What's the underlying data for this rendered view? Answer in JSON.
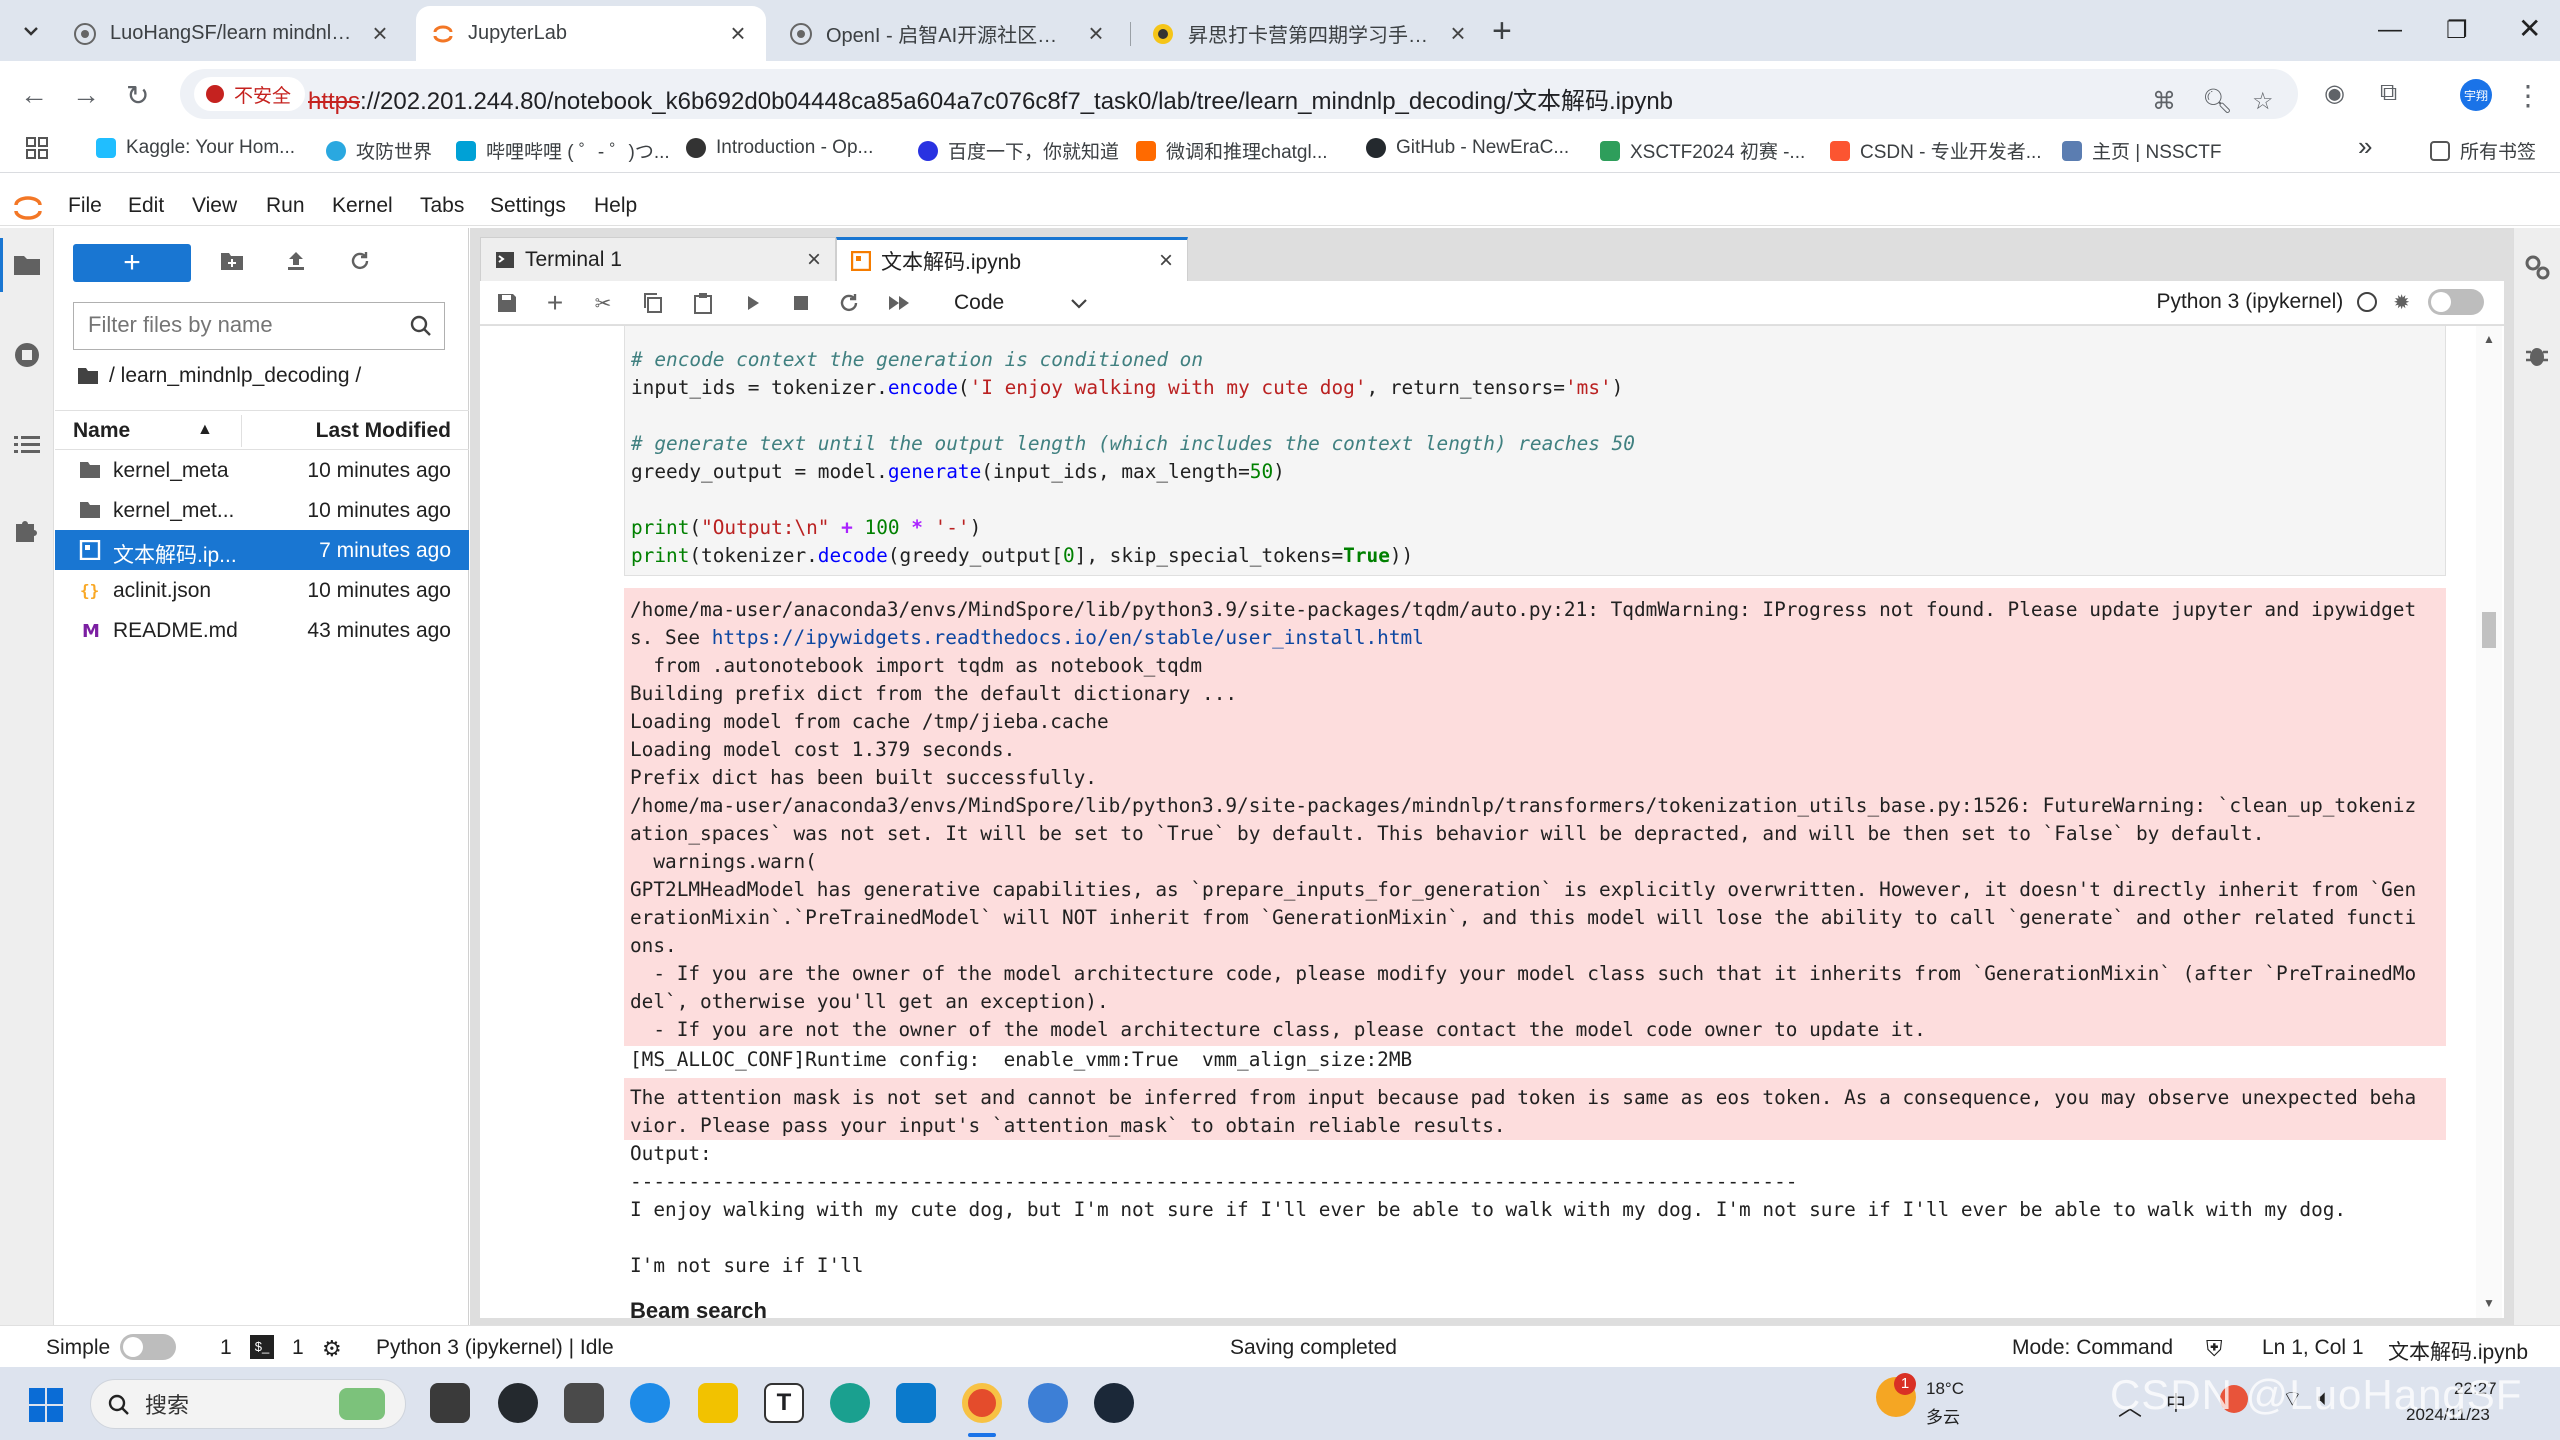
{
  "browser": {
    "tabs": [
      {
        "title": "LuoHangSF/learn mindnlp d",
        "icon": "github-icon"
      },
      {
        "title": "JupyterLab",
        "icon": "jupyter-icon",
        "active": true
      },
      {
        "title": "OpenI - 启智AI开源社区提供普",
        "icon": "openi-icon"
      },
      {
        "title": "昇思打卡营第四期学习手册（记",
        "icon": "mindspore-icon"
      }
    ],
    "security_label": "不安全",
    "url_scheme": "https",
    "url_rest": "://202.201.244.80/notebook_k6b692d0b04448ca85a604a7c076c8f7_task0/lab/tree/learn_mindnlp_decoding/文本解码.ipynb",
    "avatar_label": "宇翔",
    "bookmarks": [
      {
        "label": "Kaggle: Your Hom...",
        "color": "#20beff"
      },
      {
        "label": "攻防世界",
        "color": "#2aa8e0"
      },
      {
        "label": "哔哩哔哩 ( ゜- ゜)つ...",
        "color": "#00a1d6"
      },
      {
        "label": "Introduction - Op...",
        "color": "#333333"
      },
      {
        "label": "百度一下，你就知道",
        "color": "#2932e1"
      },
      {
        "label": "微调和推理chatgl...",
        "color": "#ff6a00"
      },
      {
        "label": "GitHub - NewEraC...",
        "color": "#24292e"
      },
      {
        "label": "XSCTF2024 初赛 -...",
        "color": "#2e9e5b"
      },
      {
        "label": "CSDN - 专业开发者...",
        "color": "#fc5531"
      },
      {
        "label": "主页 | NSSCTF",
        "color": "#5b7db1"
      }
    ],
    "bookmarks_more": "»",
    "all_bookmarks": "所有书签"
  },
  "jupyter": {
    "menu": [
      "File",
      "Edit",
      "View",
      "Run",
      "Kernel",
      "Tabs",
      "Settings",
      "Help"
    ],
    "filter_placeholder": "Filter files by name",
    "breadcrumb": "/ learn_mindnlp_decoding /",
    "columns": {
      "name": "Name",
      "modified": "Last Modified"
    },
    "files": [
      {
        "name": "kernel_meta",
        "modified": "10 minutes ago",
        "type": "folder"
      },
      {
        "name": "kernel_met...",
        "modified": "10 minutes ago",
        "type": "folder"
      },
      {
        "name": "文本解码.ip...",
        "modified": "7 minutes ago",
        "type": "notebook",
        "selected": true
      },
      {
        "name": "aclinit.json",
        "modified": "10 minutes ago",
        "type": "json"
      },
      {
        "name": "README.md",
        "modified": "43 minutes ago",
        "type": "markdown"
      }
    ],
    "doc_tabs": [
      {
        "label": "Terminal 1"
      },
      {
        "label": "文本解码.ipynb",
        "active": true
      }
    ],
    "cell_type": "Code",
    "kernel_name": "Python 3 (ipykernel)"
  },
  "notebook": {
    "code": {
      "c1": "# encode context the generation is conditioned on",
      "l2a": "input_ids = tokenizer.",
      "l2b": "encode",
      "l2c": "(",
      "l2d": "'I enjoy walking with my cute dog'",
      "l2e": ", return_tensors=",
      "l2f": "'ms'",
      "l2g": ")",
      "c3": "# generate text until the output length (which includes the context length) reaches 50",
      "l4a": "greedy_output = model.",
      "l4b": "generate",
      "l4c": "(input_ids, max_length=",
      "l4d": "50",
      "l4e": ")",
      "l5a": "print",
      "l5b": "(",
      "l5c": "\"Output:\\n\"",
      "l5d": " + ",
      "l5e": "100",
      "l5f": " * ",
      "l5g": "'-'",
      "l5h": ")",
      "l6a": "print",
      "l6b": "(tokenizer.",
      "l6c": "decode",
      "l6d": "(greedy_output[",
      "l6e": "0",
      "l6f": "], skip_special_tokens=",
      "l6g": "True",
      "l6h": "))"
    },
    "err1": [
      "/home/ma-user/anaconda3/envs/MindSpore/lib/python3.9/site-packages/tqdm/auto.py:21: TqdmWarning: IProgress not found. Please update jupyter and ipywidget",
      "s. See ",
      "https://ipywidgets.readthedocs.io/en/stable/user_install.html",
      "  from .autonotebook import tqdm as notebook_tqdm",
      "Building prefix dict from the default dictionary ...",
      "Loading model from cache /tmp/jieba.cache",
      "Loading model cost 1.379 seconds.",
      "Prefix dict has been built successfully.",
      "/home/ma-user/anaconda3/envs/MindSpore/lib/python3.9/site-packages/mindnlp/transformers/tokenization_utils_base.py:1526: FutureWarning: `clean_up_tokeniz",
      "ation_spaces` was not set. It will be set to `True` by default. This behavior will be depracted, and will be then set to `False` by default.",
      "  warnings.warn(",
      "GPT2LMHeadModel has generative capabilities, as `prepare_inputs_for_generation` is explicitly overwritten. However, it doesn't directly inherit from `Gen",
      "erationMixin`.`PreTrainedModel` will NOT inherit from `GenerationMixin`, and this model will lose the ability to call `generate` and other related functi",
      "ons.",
      "  - If you are the owner of the model architecture code, please modify your model class such that it inherits from `GenerationMixin` (after `PreTrainedMo",
      "del`, otherwise you'll get an exception).",
      "  - If you are not the owner of the model architecture class, please contact the model code owner to update it."
    ],
    "plain1": "[MS_ALLOC_CONF]Runtime config:  enable_vmm:True  vmm_align_size:2MB",
    "err2": [
      "The attention mask is not set and cannot be inferred from input because pad token is same as eos token. As a consequence, you may observe unexpected beha",
      "vior. Please pass your input's `attention_mask` to obtain reliable results."
    ],
    "out": [
      "Output:",
      "----------------------------------------------------------------------------------------------------",
      "I enjoy walking with my cute dog, but I'm not sure if I'll ever be able to walk with my dog. I'm not sure if I'll ever be able to walk with my dog.",
      "",
      "I'm not sure if I'll"
    ],
    "next_heading": "Beam search"
  },
  "status": {
    "mode_label": "Simple",
    "count1": "1",
    "count2": "1",
    "kernel_state": "Python 3 (ipykernel) | Idle",
    "message": "Saving completed",
    "mode": "Mode: Command",
    "position": "Ln 1, Col 1",
    "filename": "文本解码.ipynb"
  },
  "taskbar": {
    "search_placeholder": "搜索",
    "weather_temp": "18°C",
    "weather_desc": "多云",
    "weather_badge": "1",
    "time": "22:27",
    "date": "2024/11/23",
    "ime": "中",
    "watermark": "CSDN @LuoHangSF"
  }
}
